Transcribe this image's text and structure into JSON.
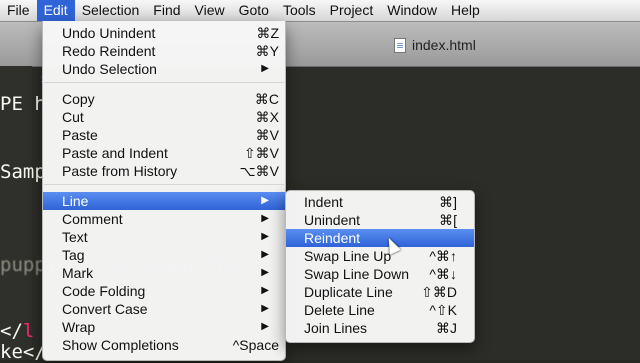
{
  "menubar": {
    "items": [
      "File",
      "Edit",
      "Selection",
      "Find",
      "View",
      "Goto",
      "Tools",
      "Project",
      "Window",
      "Help"
    ]
  },
  "editor": {
    "tab_title": "index.html",
    "tab_close": "✕",
    "code": {
      "l1": "PE h",
      "l2": "Samp",
      "l3": "puppy     erstood four",
      "l4": "</",
      "l4b": "l",
      "l5": "ke</"
    }
  },
  "edit_menu": {
    "undo": {
      "label": "Undo Unindent",
      "shortcut": "⌘Z"
    },
    "redo": {
      "label": "Redo Reindent",
      "shortcut": "⌘Y"
    },
    "undo_selection": {
      "label": "Undo Selection",
      "arrow": "▶"
    },
    "copy": {
      "label": "Copy",
      "shortcut": "⌘C"
    },
    "cut": {
      "label": "Cut",
      "shortcut": "⌘X"
    },
    "paste": {
      "label": "Paste",
      "shortcut": "⌘V"
    },
    "paste_indent": {
      "label": "Paste and Indent",
      "shortcut": "⇧⌘V"
    },
    "paste_history": {
      "label": "Paste from History",
      "shortcut": "⌥⌘V"
    },
    "line": {
      "label": "Line",
      "arrow": "▶"
    },
    "comment": {
      "label": "Comment",
      "arrow": "▶"
    },
    "text": {
      "label": "Text",
      "arrow": "▶"
    },
    "tag": {
      "label": "Tag",
      "arrow": "▶"
    },
    "mark": {
      "label": "Mark",
      "arrow": "▶"
    },
    "code_folding": {
      "label": "Code Folding",
      "arrow": "▶"
    },
    "convert_case": {
      "label": "Convert Case",
      "arrow": "▶"
    },
    "wrap": {
      "label": "Wrap",
      "arrow": "▶"
    },
    "show_completions": {
      "label": "Show Completions",
      "shortcut": "^Space"
    }
  },
  "line_menu": {
    "indent": {
      "label": "Indent",
      "shortcut": "⌘]"
    },
    "unindent": {
      "label": "Unindent",
      "shortcut": "⌘["
    },
    "reindent": {
      "label": "Reindent",
      "shortcut": ""
    },
    "swap_up": {
      "label": "Swap Line Up",
      "shortcut": "^⌘↑"
    },
    "swap_down": {
      "label": "Swap Line Down",
      "shortcut": "^⌘↓"
    },
    "duplicate": {
      "label": "Duplicate Line",
      "shortcut": "⇧⌘D"
    },
    "delete": {
      "label": "Delete Line",
      "shortcut": "^⇧K"
    },
    "join": {
      "label": "Join Lines",
      "shortcut": "⌘J"
    }
  },
  "colors": {
    "highlight": "#2f63d8",
    "editor_bg": "#2c2d28"
  }
}
